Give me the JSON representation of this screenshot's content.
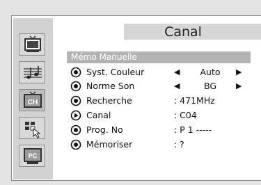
{
  "title": "Canal",
  "section_header": "Mémo Manuelle",
  "sidebar": [
    {
      "icon": "picture-icon",
      "active": false
    },
    {
      "icon": "sound-icon",
      "active": false
    },
    {
      "icon": "channel-icon",
      "label": "CH",
      "active": true
    },
    {
      "icon": "setup-icon",
      "active": false
    },
    {
      "icon": "pc-icon",
      "label": "PC",
      "active": false
    }
  ],
  "menu": [
    {
      "label": "Syst. Couleur",
      "value": "Auto",
      "arrows": true,
      "selected": false
    },
    {
      "label": "Norme Son",
      "value": "BG",
      "arrows": true,
      "selected": false
    },
    {
      "label": "Recherche",
      "value": ": 471MHz",
      "arrows": false,
      "selected": false
    },
    {
      "label": "Canal",
      "value": ": C04",
      "arrows": false,
      "selected": true
    },
    {
      "label": "Prog. No",
      "value": ": P 1 -----",
      "arrows": false,
      "selected": false
    },
    {
      "label": "Mémoriser",
      "value": ": ?",
      "arrows": false,
      "selected": false
    }
  ],
  "arrows": {
    "left": "◀",
    "right": "▶"
  }
}
